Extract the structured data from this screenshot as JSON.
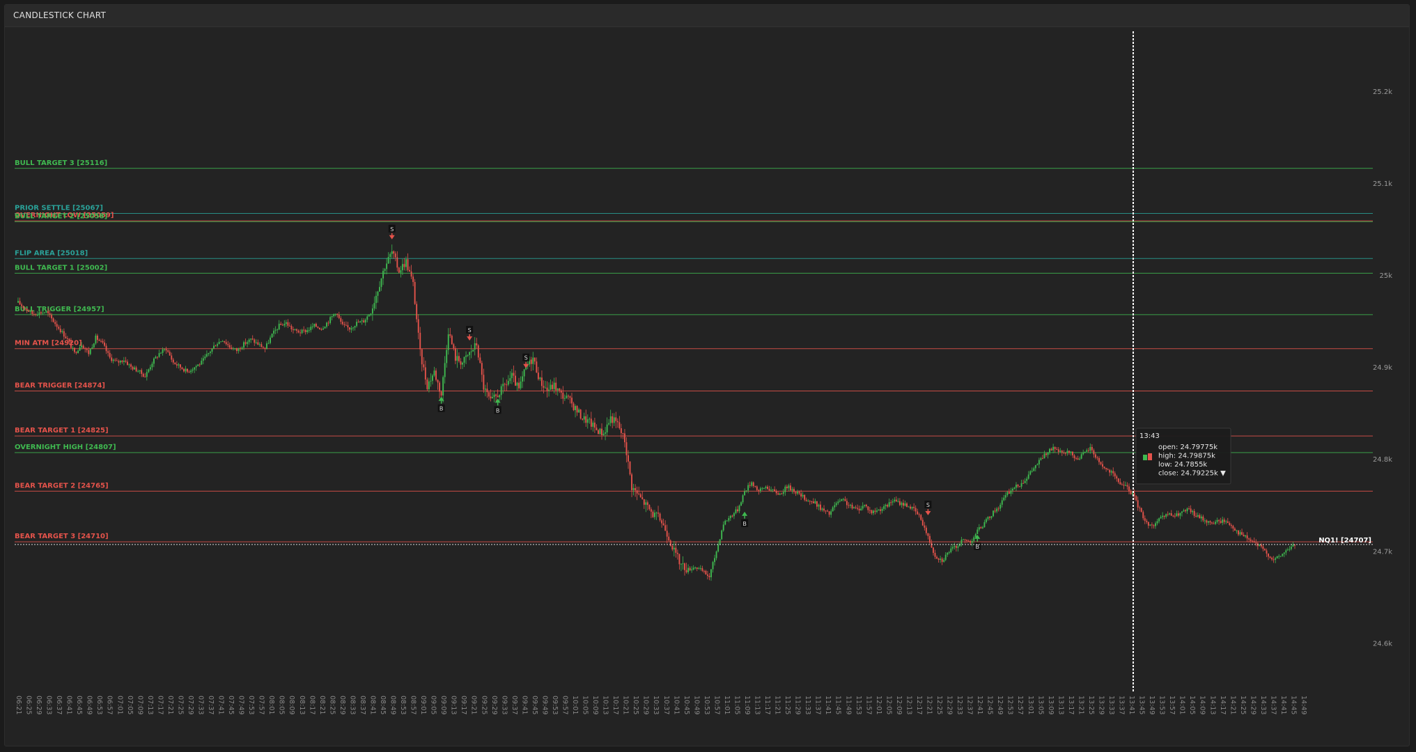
{
  "header": {
    "title": "CANDLESTICK CHART"
  },
  "colors": {
    "up": "#3fb950",
    "down": "#e5534b",
    "bull_level": "#3fb950",
    "bear_level": "#e5534b",
    "teal_level": "#2aa198",
    "crosshair": "#ffffff"
  },
  "chart_data": {
    "type": "candlestick",
    "title": "CANDLESTICK CHART",
    "xlabel": "",
    "ylabel": "",
    "ylim": [
      24570,
      25265
    ],
    "y_ticks": [
      {
        "value": 25200,
        "label": "25.2k"
      },
      {
        "value": 25100,
        "label": "25.1k"
      },
      {
        "value": 25000,
        "label": "25k"
      },
      {
        "value": 24900,
        "label": "24.9k"
      },
      {
        "value": 24800,
        "label": "24.8k"
      },
      {
        "value": 24700,
        "label": "24.7k"
      },
      {
        "value": 24600,
        "label": "24.6k"
      }
    ],
    "x_ticks": [
      "06:21",
      "06:25",
      "06:29",
      "06:33",
      "06:37",
      "06:41",
      "06:45",
      "06:49",
      "06:53",
      "06:57",
      "07:01",
      "07:05",
      "07:09",
      "07:13",
      "07:17",
      "07:21",
      "07:25",
      "07:29",
      "07:33",
      "07:37",
      "07:41",
      "07:45",
      "07:49",
      "07:53",
      "07:57",
      "08:01",
      "08:05",
      "08:09",
      "08:13",
      "08:17",
      "08:21",
      "08:25",
      "08:29",
      "08:33",
      "08:37",
      "08:41",
      "08:45",
      "08:49",
      "08:53",
      "08:57",
      "09:01",
      "09:05",
      "09:09",
      "09:13",
      "09:17",
      "09:21",
      "09:25",
      "09:29",
      "09:33",
      "09:37",
      "09:41",
      "09:45",
      "09:49",
      "09:53",
      "09:57",
      "10:01",
      "10:05",
      "10:09",
      "10:13",
      "10:17",
      "10:21",
      "10:25",
      "10:29",
      "10:33",
      "10:37",
      "10:41",
      "10:45",
      "10:49",
      "10:53",
      "10:57",
      "11:01",
      "11:05",
      "11:09",
      "11:13",
      "11:17",
      "11:21",
      "11:25",
      "11:29",
      "11:33",
      "11:37",
      "11:41",
      "11:45",
      "11:49",
      "11:53",
      "11:57",
      "12:01",
      "12:05",
      "12:09",
      "12:13",
      "12:17",
      "12:21",
      "12:25",
      "12:29",
      "12:33",
      "12:37",
      "12:41",
      "12:45",
      "12:49",
      "12:53",
      "12:57",
      "13:01",
      "13:05",
      "13:09",
      "13:13",
      "13:17",
      "13:21",
      "13:25",
      "13:29",
      "13:33",
      "13:37",
      "13:41",
      "13:45",
      "13:49",
      "13:53",
      "13:57",
      "14:01",
      "14:05",
      "14:09",
      "14:13",
      "14:17",
      "14:21",
      "14:25",
      "14:29",
      "14:33",
      "14:37",
      "14:41",
      "14:45",
      "14:49"
    ],
    "price_path": [
      [
        0,
        24970
      ],
      [
        8,
        24958
      ],
      [
        16,
        24960
      ],
      [
        20,
        24950
      ],
      [
        28,
        24930
      ],
      [
        32,
        24915
      ],
      [
        36,
        24925
      ],
      [
        40,
        24915
      ],
      [
        44,
        24932
      ],
      [
        48,
        24925
      ],
      [
        52,
        24910
      ],
      [
        56,
        24905
      ],
      [
        60,
        24908
      ],
      [
        64,
        24900
      ],
      [
        68,
        24896
      ],
      [
        72,
        24890
      ],
      [
        76,
        24905
      ],
      [
        80,
        24915
      ],
      [
        84,
        24920
      ],
      [
        88,
        24905
      ],
      [
        92,
        24900
      ],
      [
        96,
        24895
      ],
      [
        100,
        24900
      ],
      [
        104,
        24905
      ],
      [
        108,
        24915
      ],
      [
        112,
        24925
      ],
      [
        116,
        24930
      ],
      [
        120,
        24922
      ],
      [
        124,
        24918
      ],
      [
        128,
        24925
      ],
      [
        132,
        24930
      ],
      [
        136,
        24925
      ],
      [
        140,
        24920
      ],
      [
        144,
        24935
      ],
      [
        148,
        24945
      ],
      [
        152,
        24948
      ],
      [
        156,
        24940
      ],
      [
        160,
        24938
      ],
      [
        164,
        24940
      ],
      [
        168,
        24945
      ],
      [
        172,
        24942
      ],
      [
        176,
        24950
      ],
      [
        180,
        24960
      ],
      [
        184,
        24945
      ],
      [
        188,
        24942
      ],
      [
        192,
        24948
      ],
      [
        196,
        24950
      ],
      [
        200,
        24960
      ],
      [
        204,
        24985
      ],
      [
        208,
        25010
      ],
      [
        212,
        25025
      ],
      [
        216,
        25005
      ],
      [
        220,
        25015
      ],
      [
        224,
        24990
      ],
      [
        228,
        24915
      ],
      [
        232,
        24880
      ],
      [
        236,
        24895
      ],
      [
        240,
        24870
      ],
      [
        244,
        24940
      ],
      [
        248,
        24910
      ],
      [
        252,
        24905
      ],
      [
        256,
        24915
      ],
      [
        260,
        24925
      ],
      [
        264,
        24878
      ],
      [
        268,
        24862
      ],
      [
        272,
        24870
      ],
      [
        276,
        24880
      ],
      [
        280,
        24890
      ],
      [
        284,
        24875
      ],
      [
        288,
        24900
      ],
      [
        292,
        24910
      ],
      [
        296,
        24885
      ],
      [
        300,
        24875
      ],
      [
        304,
        24880
      ],
      [
        308,
        24870
      ],
      [
        312,
        24865
      ],
      [
        316,
        24855
      ],
      [
        320,
        24845
      ],
      [
        324,
        24840
      ],
      [
        328,
        24832
      ],
      [
        332,
        24828
      ],
      [
        336,
        24845
      ],
      [
        340,
        24838
      ],
      [
        344,
        24820
      ],
      [
        348,
        24770
      ],
      [
        352,
        24760
      ],
      [
        356,
        24750
      ],
      [
        360,
        24740
      ],
      [
        364,
        24735
      ],
      [
        368,
        24720
      ],
      [
        372,
        24700
      ],
      [
        376,
        24685
      ],
      [
        380,
        24680
      ],
      [
        384,
        24683
      ],
      [
        388,
        24678
      ],
      [
        392,
        24672
      ],
      [
        396,
        24700
      ],
      [
        400,
        24730
      ],
      [
        404,
        24738
      ],
      [
        408,
        24745
      ],
      [
        412,
        24765
      ],
      [
        416,
        24775
      ],
      [
        420,
        24765
      ],
      [
        424,
        24770
      ],
      [
        428,
        24765
      ],
      [
        432,
        24762
      ],
      [
        436,
        24770
      ],
      [
        440,
        24766
      ],
      [
        444,
        24760
      ],
      [
        448,
        24755
      ],
      [
        452,
        24752
      ],
      [
        456,
        24745
      ],
      [
        460,
        24740
      ],
      [
        464,
        24752
      ],
      [
        468,
        24755
      ],
      [
        472,
        24748
      ],
      [
        476,
        24745
      ],
      [
        480,
        24750
      ],
      [
        484,
        24742
      ],
      [
        488,
        24745
      ],
      [
        492,
        24748
      ],
      [
        496,
        24755
      ],
      [
        500,
        24752
      ],
      [
        504,
        24750
      ],
      [
        508,
        24745
      ],
      [
        512,
        24735
      ],
      [
        516,
        24715
      ],
      [
        520,
        24695
      ],
      [
        524,
        24690
      ],
      [
        528,
        24700
      ],
      [
        532,
        24705
      ],
      [
        536,
        24712
      ],
      [
        540,
        24710
      ],
      [
        544,
        24722
      ],
      [
        548,
        24730
      ],
      [
        552,
        24740
      ],
      [
        556,
        24748
      ],
      [
        560,
        24760
      ],
      [
        564,
        24768
      ],
      [
        568,
        24772
      ],
      [
        572,
        24780
      ],
      [
        576,
        24790
      ],
      [
        580,
        24800
      ],
      [
        584,
        24808
      ],
      [
        588,
        24812
      ],
      [
        592,
        24805
      ],
      [
        596,
        24808
      ],
      [
        600,
        24800
      ],
      [
        604,
        24805
      ],
      [
        608,
        24812
      ],
      [
        612,
        24800
      ],
      [
        616,
        24790
      ],
      [
        620,
        24785
      ],
      [
        624,
        24775
      ],
      [
        628,
        24770
      ],
      [
        632,
        24762
      ],
      [
        636,
        24745
      ],
      [
        640,
        24730
      ],
      [
        644,
        24728
      ],
      [
        648,
        24735
      ],
      [
        652,
        24740
      ],
      [
        656,
        24738
      ],
      [
        660,
        24742
      ],
      [
        664,
        24745
      ],
      [
        668,
        24738
      ],
      [
        672,
        24735
      ],
      [
        676,
        24730
      ],
      [
        680,
        24732
      ],
      [
        684,
        24733
      ],
      [
        688,
        24728
      ],
      [
        692,
        24720
      ],
      [
        696,
        24715
      ],
      [
        700,
        24710
      ],
      [
        704,
        24705
      ],
      [
        708,
        24698
      ],
      [
        712,
        24690
      ],
      [
        716,
        24695
      ],
      [
        720,
        24702
      ],
      [
        724,
        24707
      ]
    ],
    "total_bars": 725,
    "levels": [
      {
        "label": "BULL TARGET 3 [25116]",
        "value": 25116,
        "kind": "bull"
      },
      {
        "label": "PRIOR SETTLE [25067]",
        "value": 25067,
        "kind": "teal"
      },
      {
        "label": "OVERNIGHT LOW [25059]",
        "value": 25059,
        "kind": "bear"
      },
      {
        "label": "BULL TARGET 2 [25058]",
        "value": 25058,
        "kind": "bull"
      },
      {
        "label": "FLIP AREA [25018]",
        "value": 25018,
        "kind": "teal"
      },
      {
        "label": "BULL TARGET 1 [25002]",
        "value": 25002,
        "kind": "bull"
      },
      {
        "label": "BULL TRIGGER [24957]",
        "value": 24957,
        "kind": "bull"
      },
      {
        "label": "MIN ATM [24920]",
        "value": 24920,
        "kind": "bear"
      },
      {
        "label": "BEAR TRIGGER [24874]",
        "value": 24874,
        "kind": "bear"
      },
      {
        "label": "BEAR TARGET 1 [24825]",
        "value": 24825,
        "kind": "bear"
      },
      {
        "label": "OVERNIGHT HIGH [24807]",
        "value": 24807,
        "kind": "bull"
      },
      {
        "label": "BEAR TARGET 2 [24765]",
        "value": 24765,
        "kind": "bear"
      },
      {
        "label": "BEAR TARGET 3 [24710]",
        "value": 24710,
        "kind": "bear"
      }
    ],
    "last_price": {
      "label": "NQ1! [24707]",
      "value": 24707
    },
    "signals": [
      {
        "type": "S",
        "bar": 212,
        "price": 25035
      },
      {
        "type": "B",
        "bar": 240,
        "price": 24870
      },
      {
        "type": "S",
        "bar": 256,
        "price": 24925
      },
      {
        "type": "B",
        "bar": 272,
        "price": 24868
      },
      {
        "type": "S",
        "bar": 288,
        "price": 24895
      },
      {
        "type": "S",
        "bar": 516,
        "price": 24735
      },
      {
        "type": "B",
        "bar": 412,
        "price": 24745
      },
      {
        "type": "B",
        "bar": 544,
        "price": 24720
      }
    ],
    "crosshair": {
      "time": "13:43"
    },
    "tooltip": {
      "time": "13:43",
      "open": "open: 24.79775k",
      "high": "high: 24.79875k",
      "low": "low: 24.7855k",
      "close": "close: 24.79225k",
      "caret": "▼"
    }
  }
}
